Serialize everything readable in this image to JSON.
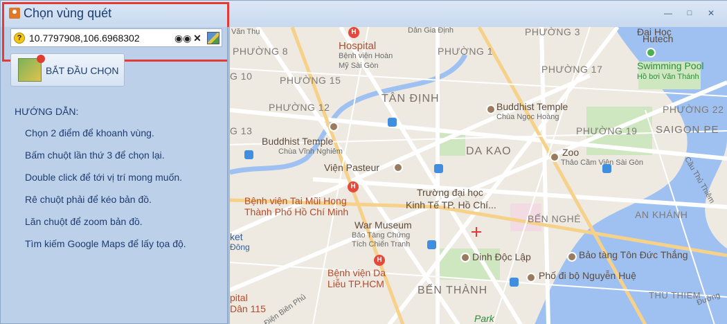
{
  "window": {
    "title": "Chọn vùng quét"
  },
  "coords": {
    "value": "10.7797908,106.6968302"
  },
  "start_button": {
    "label": "BẮT ĐẦU CHỌN"
  },
  "guide": {
    "title": "HƯỚNG DẪN:",
    "items": [
      "Chọn 2 điểm để khoanh vùng.",
      "Bấm chuột lần thứ 3 để chọn lại.",
      "Double click để tới vị trí mong muốn.",
      "Rê chuột phải để kéo bản đồ.",
      "Lăn chuột để zoom bản đồ.",
      "Tìm kiếm Google Maps để lấy tọa độ."
    ]
  },
  "map": {
    "labels": {
      "van_thu": "Văn Thụ",
      "phuong8": "PHƯỜNG 8",
      "g10": "G 10",
      "phuong15": "PHƯỜNG 15",
      "phuong12": "PHƯỜNG 12",
      "g13": "G 13",
      "hospital": "Hospital",
      "hospital_sub1": "Bệnh viện Hoàn",
      "hospital_sub2": "Mỹ Sài Gòn",
      "dan_gia_dinh": "Dân Gia Định",
      "phuong1": "PHƯỜNG 1",
      "phuong3": "PHƯỜNG 3",
      "dai_hoc": "Đại Học",
      "hutech": "Hutech",
      "phuong17": "PHƯỜNG 17",
      "swimming": "Swimming Pool",
      "swimming_sub": "Hồ bơi Văn Thánh",
      "tan_dinh": "TÂN ĐỊNH",
      "buddhist1": "Buddhist Temple",
      "buddhist1_sub": "Chùa Ngọc Hoàng",
      "phuong22": "PHƯỜNG 22",
      "phuong19": "PHƯỜNG 19",
      "saigon_pe": "SAIGON PE",
      "buddhist2": "Buddhist Temple",
      "buddhist2_sub": "Chùa Vĩnh Nghiêm",
      "da_kao": "DA KAO",
      "zoo": "Zoo",
      "zoo_sub": "Thảo Cầm Viên Sài Gòn",
      "pasteur": "Viện Pasteur",
      "benh_vien_tmh1": "Bệnh viện Tai Mũi Hong",
      "benh_vien_tmh2": "Thành Phố Hồ Chí Minh",
      "truong1": "Trường đại học",
      "truong2": "Kinh Tế TP. Hồ Chí...",
      "ben_nghe": "BẾN NGHÉ",
      "an_khanh": "AN KHÁNH",
      "war1": "War Museum",
      "war2": "Bảo Tàng Chứng",
      "war3": "Tích Chiến Tranh",
      "ket": "ket",
      "dong": "Đông",
      "dinh": "Dinh Độc Lập",
      "bao_tang": "Bảo tàng Tôn Đức Thắng",
      "bv_da1": "Bệnh viện Da",
      "bv_da2": "Liễu TP.HCM",
      "pho_di_bo": "Phố đi bộ Nguyễn Huệ",
      "ben_thanh": "BẾN THÀNH",
      "thu_thiem": "THU THIEM",
      "pital": "pital",
      "dan115": "Dân 115",
      "park": "Park",
      "duong": "Đường",
      "dien_bien": "Điện Biên Phủ",
      "cau_thu_thiem": "Cầu Thủ Thiêm"
    }
  }
}
